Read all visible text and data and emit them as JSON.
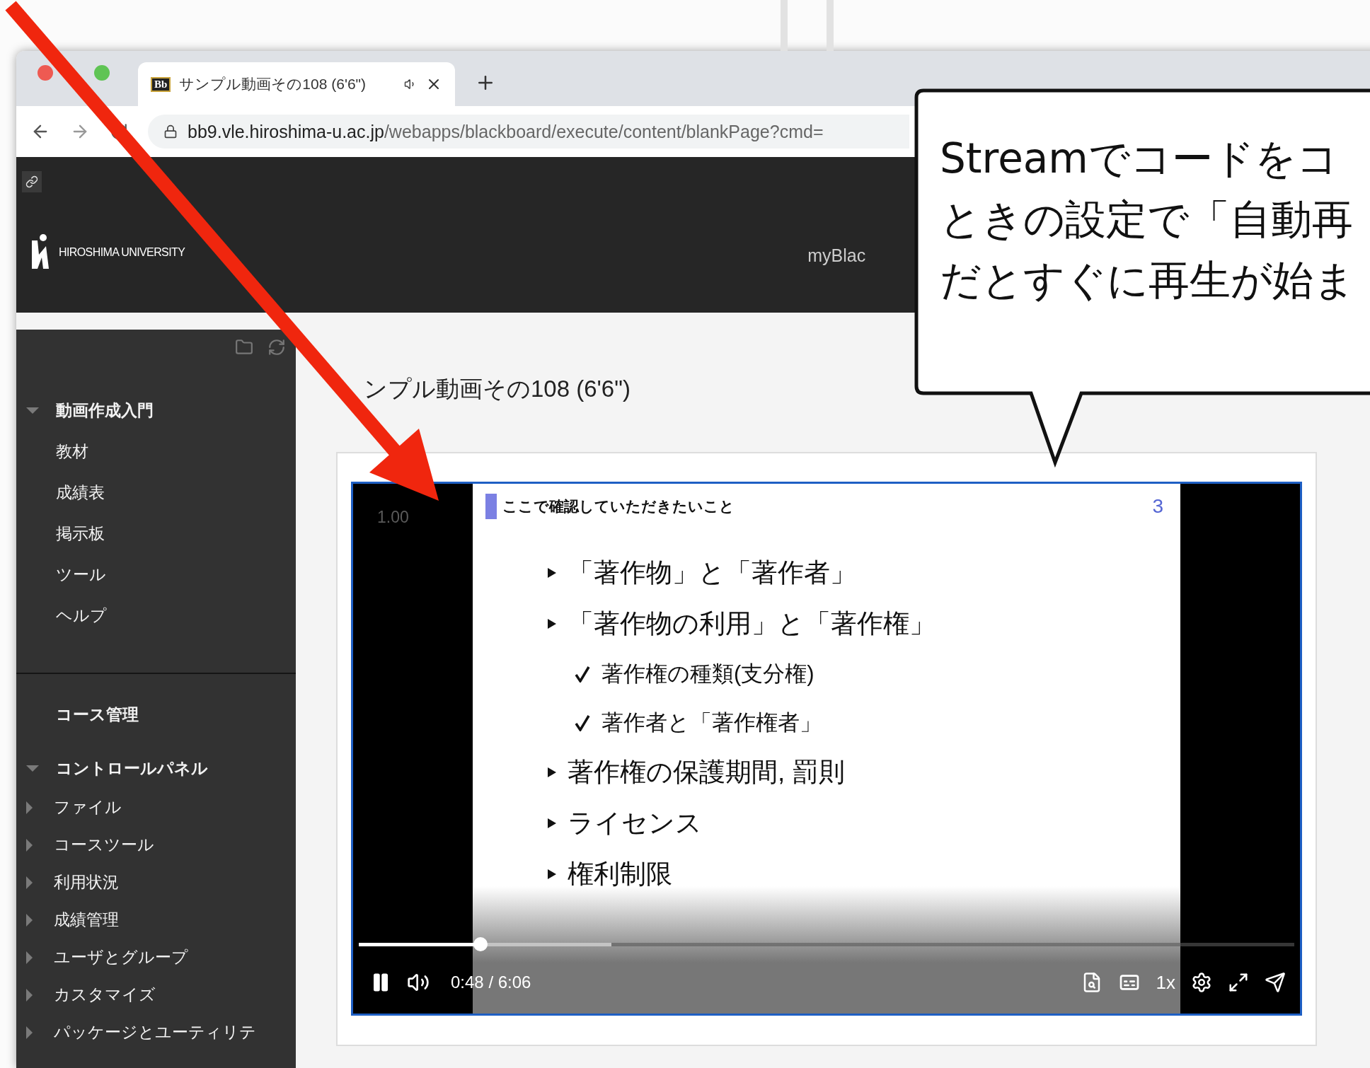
{
  "browser": {
    "tab": {
      "favicon": "Bb",
      "title": "サンプル動画その108 (6'6\")",
      "selected": true
    },
    "url": {
      "host": "bb9.vle.hiroshima-u.ac.jp",
      "path": "/webapps/blackboard/execute/content/blankPage?cmd="
    }
  },
  "header": {
    "logo": "HIROSHIMA UNIVERSITY",
    "nav_link": "myBlac"
  },
  "sidebar": {
    "items": [
      {
        "label": "動画作成入門",
        "kind": "folder",
        "expanded": true,
        "children": [
          {
            "label": "教材",
            "kind": "link"
          },
          {
            "label": "成績表",
            "kind": "link"
          },
          {
            "label": "掲示板",
            "kind": "link"
          },
          {
            "label": "ツール",
            "kind": "link"
          },
          {
            "label": "ヘルプ",
            "kind": "link"
          }
        ]
      },
      {
        "label": "コース管理",
        "kind": "heading"
      },
      {
        "label": "コントロールパネル",
        "kind": "folder",
        "expanded": true,
        "children": [
          {
            "label": "ファイル",
            "kind": "folder",
            "expanded": false
          },
          {
            "label": "コースツール",
            "kind": "folder",
            "expanded": false
          },
          {
            "label": "利用状況",
            "kind": "folder",
            "expanded": false
          },
          {
            "label": "成績管理",
            "kind": "folder",
            "expanded": false
          },
          {
            "label": "ユーザとグループ",
            "kind": "folder",
            "expanded": false
          },
          {
            "label": "カスタマイズ",
            "kind": "folder",
            "expanded": false
          },
          {
            "label": "パッケージとユーティリテ",
            "kind": "folder",
            "expanded": false
          }
        ]
      }
    ]
  },
  "page": {
    "title": "ンプル動画その108 (6'6\")"
  },
  "video": {
    "speed_overlay": "1.00",
    "slide": {
      "heading": "ここで確認していただきたいこと",
      "page_number": "3",
      "bullets": [
        {
          "kind": "arrow",
          "text": "「著作物」と「著作者」"
        },
        {
          "kind": "arrow",
          "text": "「著作物の利用」と「著作権」"
        },
        {
          "kind": "check",
          "text": "著作権の種類(支分権)"
        },
        {
          "kind": "check",
          "text": "著作者と「著作権者」"
        },
        {
          "kind": "arrow",
          "text": "著作権の保護期間, 罰則"
        },
        {
          "kind": "arrow",
          "text": "ライセンス"
        },
        {
          "kind": "arrow",
          "text": "権利制限"
        }
      ]
    },
    "seek": {
      "level": 0.13,
      "buffer": {
        "level": 0.27
      }
    },
    "playing": true,
    "time": "0:48 / 6:06",
    "speed": "1x"
  },
  "callout": {
    "lines": [
      "Streamでコードをコ",
      "ときの設定で「自動再",
      "だとすぐに再生が始ま"
    ]
  }
}
